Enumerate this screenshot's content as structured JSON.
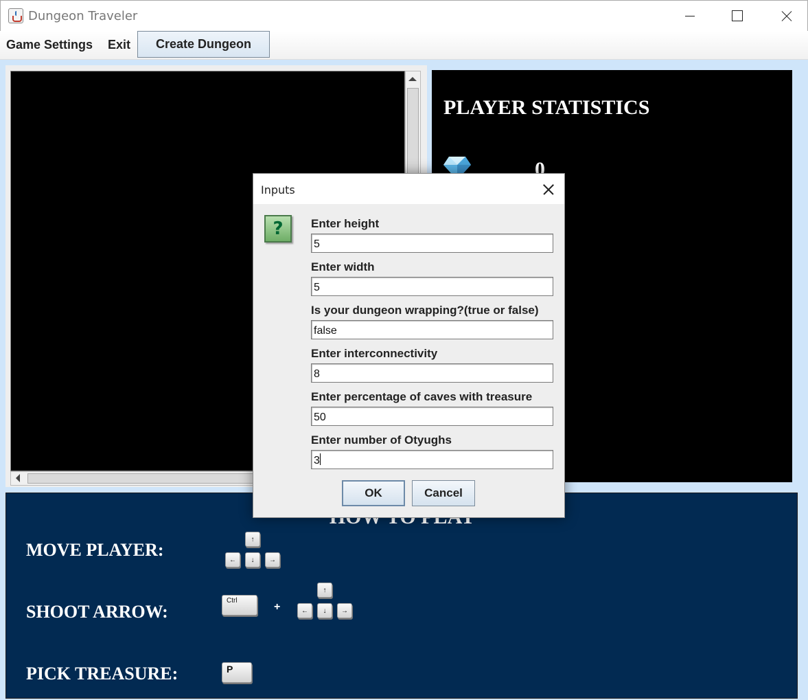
{
  "window": {
    "title": "Dungeon Traveler"
  },
  "menu": {
    "game_settings": "Game Settings",
    "exit": "Exit",
    "create_dungeon": "Create Dungeon"
  },
  "stats": {
    "title": "PLAYER STATISTICS",
    "value": "0"
  },
  "howto": {
    "title": "HOW TO PLAY",
    "move_label": "MOVE PLAYER:",
    "shoot_label": "SHOOT ARROW:",
    "pick_label": "PICK TREASURE:",
    "plus": "+",
    "key_up": "↑",
    "key_left": "←",
    "key_down": "↓",
    "key_right": "→",
    "key_ctrl": "Ctrl",
    "key_p": "P"
  },
  "dialog": {
    "title": "Inputs",
    "fields": [
      {
        "label": "Enter height",
        "value": "5"
      },
      {
        "label": "Enter width",
        "value": "5"
      },
      {
        "label": "Is your dungeon wrapping?(true or false)",
        "value": "false"
      },
      {
        "label": "Enter interconnectivity",
        "value": "8"
      },
      {
        "label": "Enter percentage of caves with treasure",
        "value": "50"
      },
      {
        "label": "Enter number of Otyughs",
        "value": "3"
      }
    ],
    "ok": "OK",
    "cancel": "Cancel"
  }
}
